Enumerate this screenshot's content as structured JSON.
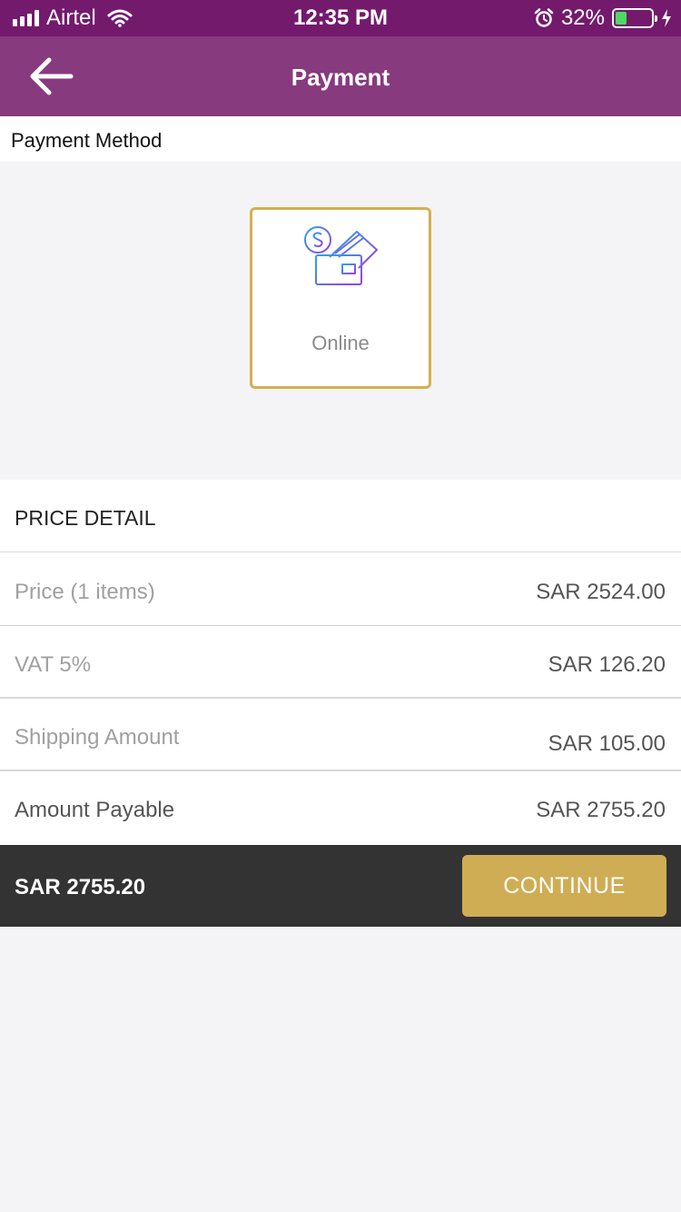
{
  "status_bar": {
    "carrier": "Airtel",
    "time": "12:35 PM",
    "battery_percent": "32%",
    "battery_level": 0.32
  },
  "app_bar": {
    "title": "Payment",
    "back_icon": "arrow-left-icon"
  },
  "payment_method": {
    "section_label": "Payment Method",
    "options": [
      {
        "label": "Online",
        "icon": "online-payment-icon",
        "selected": true
      }
    ]
  },
  "price_detail": {
    "header": "PRICE DETAIL",
    "rows": [
      {
        "label": "Price (1 items)",
        "value": "SAR 2524.00"
      },
      {
        "label": "VAT 5%",
        "value": "SAR 126.20"
      },
      {
        "label": "Shipping Amount",
        "value": "SAR 105.00"
      },
      {
        "label": "Amount Payable",
        "value": "SAR 2755.20"
      }
    ]
  },
  "bottom_bar": {
    "total": "SAR 2755.20",
    "continue_label": "CONTINUE"
  },
  "colors": {
    "status_bar": "#731a6d",
    "app_bar": "#873a7e",
    "accent_gold": "#cfad55",
    "bottom_bar": "#333333",
    "battery_green": "#4cd964"
  }
}
